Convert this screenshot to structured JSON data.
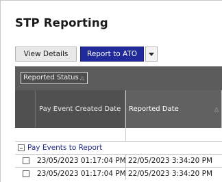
{
  "page": {
    "title": "STP Reporting"
  },
  "toolbar": {
    "view_details_label": "View Details",
    "report_to_ato_label": "Report to ATO",
    "dropdown_icon": "chevron-down-icon"
  },
  "grouping": {
    "group_by_label": "Reported Status",
    "sort_icon": "△"
  },
  "columns": {
    "created_header": "Pay Event Created Date",
    "reported_header": "Reported Date",
    "reported_sort_icon": "△"
  },
  "group": {
    "label": "Pay Events to Report"
  },
  "rows": [
    {
      "created": "23/05/2023 01:17:04 PM",
      "reported": "22/05/2023 3:34:20 PM"
    },
    {
      "created": "23/05/2023 01:17:04 PM",
      "reported": "22/05/2023 3:34:20 PM"
    }
  ],
  "colors": {
    "accent_button": "#202a9a",
    "group_link": "#1f2d8a",
    "header_bg": "#505050"
  }
}
